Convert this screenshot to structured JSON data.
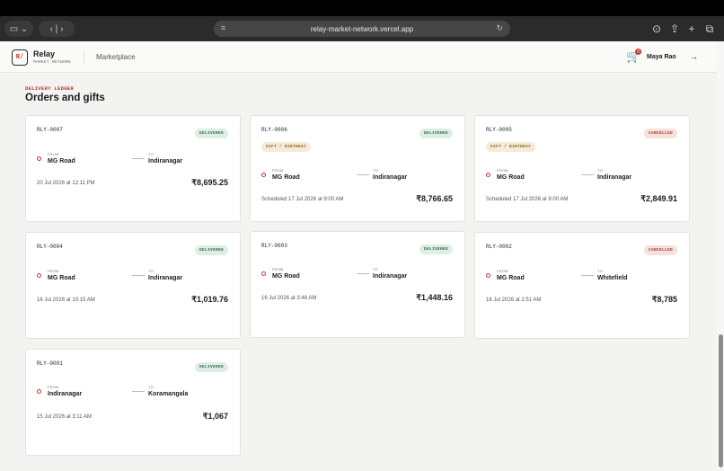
{
  "browser": {
    "url": "relay-market-network.vercel.app"
  },
  "header": {
    "logo_mark": "R/",
    "brand": "Relay",
    "brand_sub": "MARKET NETWORK",
    "nav_marketplace": "Marketplace",
    "cart_count": "0",
    "user_name": "Maya Rao"
  },
  "page": {
    "eyebrow": "DELIVERY LEDGER",
    "title": "Orders and gifts"
  },
  "labels": {
    "from": "FROM",
    "to": "TO"
  },
  "orders": [
    {
      "id": "RLY-0007",
      "status": "DELIVERED",
      "gift": "",
      "from": "MG Road",
      "to": "Indiranagar",
      "when": "20 Jul 2026 at 12:11 PM",
      "amount": "₹8,695.25"
    },
    {
      "id": "RLY-0006",
      "status": "DELIVERED",
      "gift": "GIFT / BIRTHDAY",
      "from": "MG Road",
      "to": "Indiranagar",
      "when": "Scheduled 17 Jul 2026 at 9:00 AM",
      "amount": "₹8,766.65"
    },
    {
      "id": "RLY-0005",
      "status": "CANCELLED",
      "gift": "GIFT / BIRTHDAY",
      "from": "MG Road",
      "to": "Indiranagar",
      "when": "Scheduled 17 Jul 2026 at 9:00 AM",
      "amount": "₹2,849.91"
    },
    {
      "id": "RLY-0004",
      "status": "DELIVERED",
      "gift": "",
      "from": "MG Road",
      "to": "Indiranagar",
      "when": "16 Jul 2026 at 10:15 AM",
      "amount": "₹1,019.76"
    },
    {
      "id": "RLY-0003",
      "status": "DELIVERED",
      "gift": "",
      "from": "MG Road",
      "to": "Indiranagar",
      "when": "16 Jul 2026 at 3:48 AM",
      "amount": "₹1,448.16"
    },
    {
      "id": "RLY-0002",
      "status": "CANCELLED",
      "gift": "",
      "from": "MG Road",
      "to": "Whitefield",
      "when": "16 Jul 2026 at 2:51 AM",
      "amount": "₹8,785"
    },
    {
      "id": "RLY-0001",
      "status": "DELIVERED",
      "gift": "",
      "from": "Indiranagar",
      "to": "Koramangala",
      "when": "15 Jul 2026 at 3:11 AM",
      "amount": "₹1,067"
    }
  ]
}
